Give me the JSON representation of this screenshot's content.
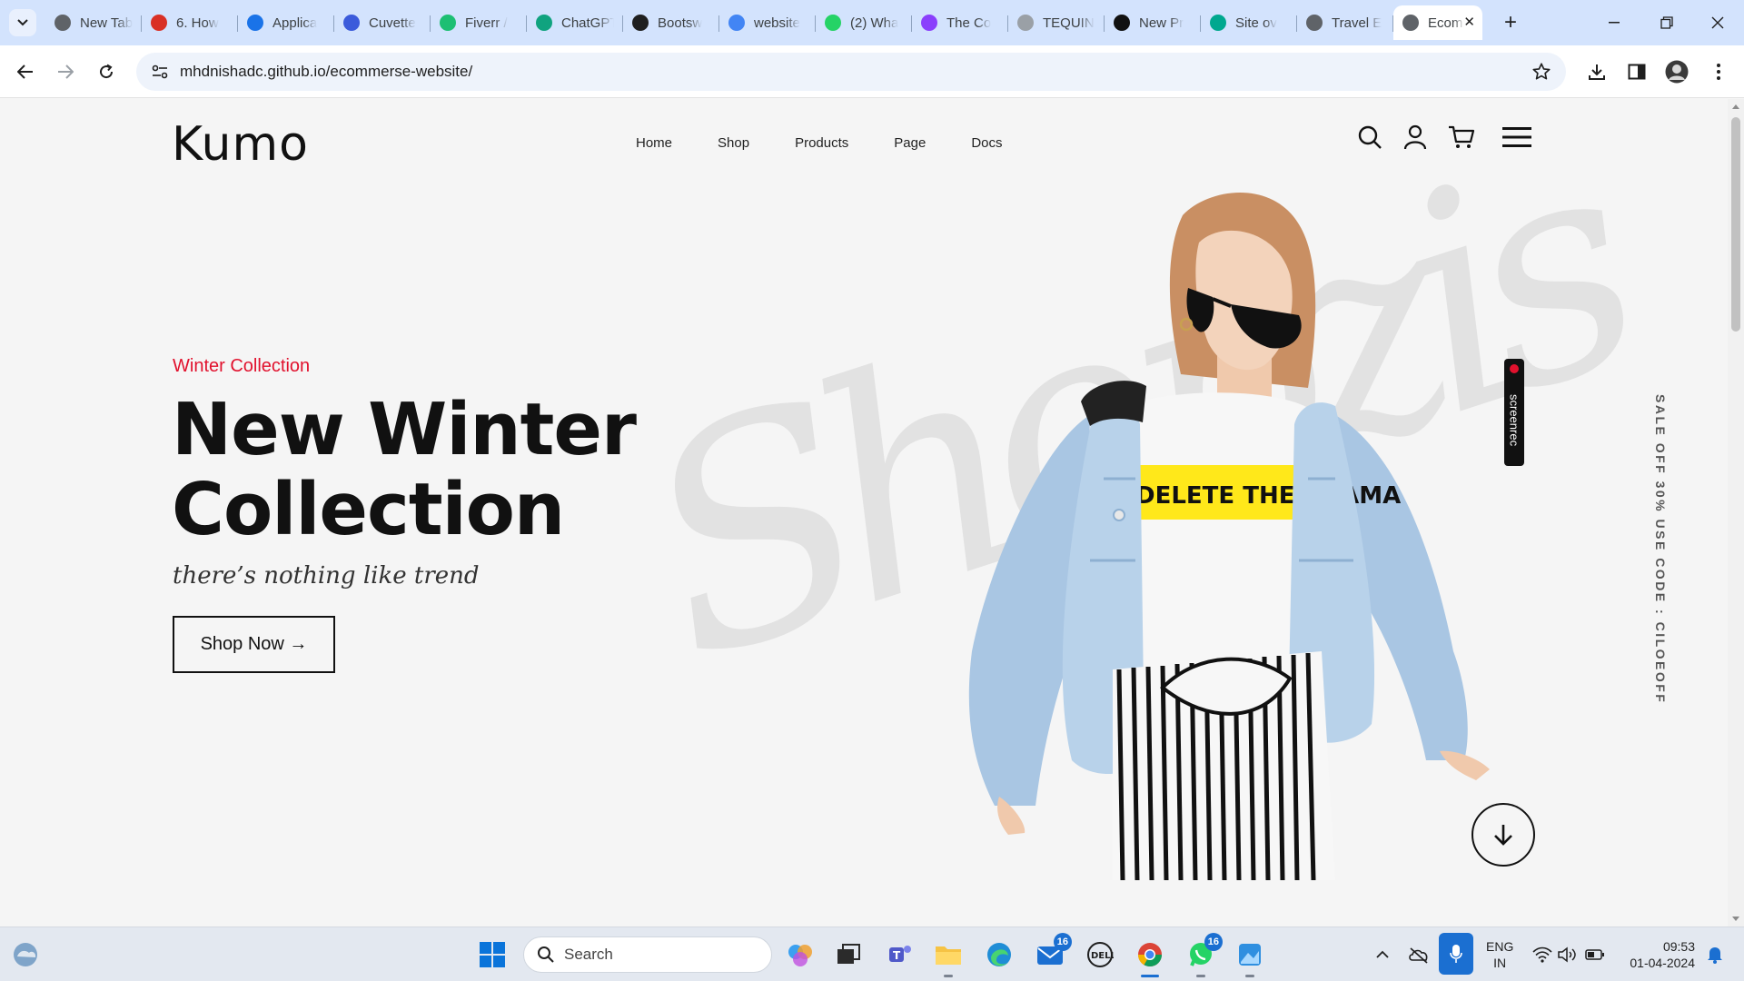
{
  "browser": {
    "tabs": [
      {
        "title": "New Tab",
        "favicon_color": "#5f6368",
        "favicon": "chrome-icon"
      },
      {
        "title": "6. How",
        "favicon_color": "#d93025",
        "favicon": "gmail-icon"
      },
      {
        "title": "Applica",
        "favicon_color": "#1a73e8",
        "favicon": "k-app-icon"
      },
      {
        "title": "Cuvette",
        "favicon_color": "#3b5bdb",
        "favicon": "cuvette-icon"
      },
      {
        "title": "Fiverr /",
        "favicon_color": "#1dbf73",
        "favicon": "fiverr-icon"
      },
      {
        "title": "ChatGPT",
        "favicon_color": "#10a37f",
        "favicon": "chatgpt-icon"
      },
      {
        "title": "Bootsw",
        "favicon_color": "#1f1f1f",
        "favicon": "bootswatch-icon"
      },
      {
        "title": "website",
        "favicon_color": "#4285f4",
        "favicon": "google-icon"
      },
      {
        "title": "(2) Wha",
        "favicon_color": "#25d366",
        "favicon": "whatsapp-icon"
      },
      {
        "title": "The Co",
        "favicon_color": "#8a3ffc",
        "favicon": "theco-icon"
      },
      {
        "title": "TEQUIN",
        "favicon_color": "#9aa0a6",
        "favicon": "tequin-icon"
      },
      {
        "title": "New Pr",
        "favicon_color": "#111111",
        "favicon": "vercel-icon"
      },
      {
        "title": "Site ov",
        "favicon_color": "#00a88f",
        "favicon": "netlify-icon"
      },
      {
        "title": "Travel E",
        "favicon_color": "#5f6368",
        "favicon": "globe-icon"
      }
    ],
    "active_tab": {
      "title": "Ecommerse",
      "favicon": "globe-icon"
    },
    "url": "mhdnishadc.github.io/ecommerse-website/"
  },
  "site": {
    "logo_text": "Kumo",
    "nav": [
      "Home",
      "Shop",
      "Products",
      "Page",
      "Docs"
    ],
    "hero": {
      "subtitle": "Winter Collection",
      "title_line1": "New Winter",
      "title_line2": "Collection",
      "tagline": "there’s nothing like trend",
      "button_label": "Shop Now →",
      "watermark": "Shopzis"
    },
    "sale_text": "SALE OFF 30% USE CODE : CILOEOFF",
    "model_shirt_text": "DELETE THE DRAMA",
    "screenrec_label": "screenrec",
    "accent_color": "#e1112d"
  },
  "taskbar": {
    "search_label": "Search",
    "mail_badge": "16",
    "whatsapp_badge": "16",
    "lang_line1": "ENG",
    "lang_line2": "IN",
    "time": "09:53",
    "date": "01-04-2024"
  }
}
